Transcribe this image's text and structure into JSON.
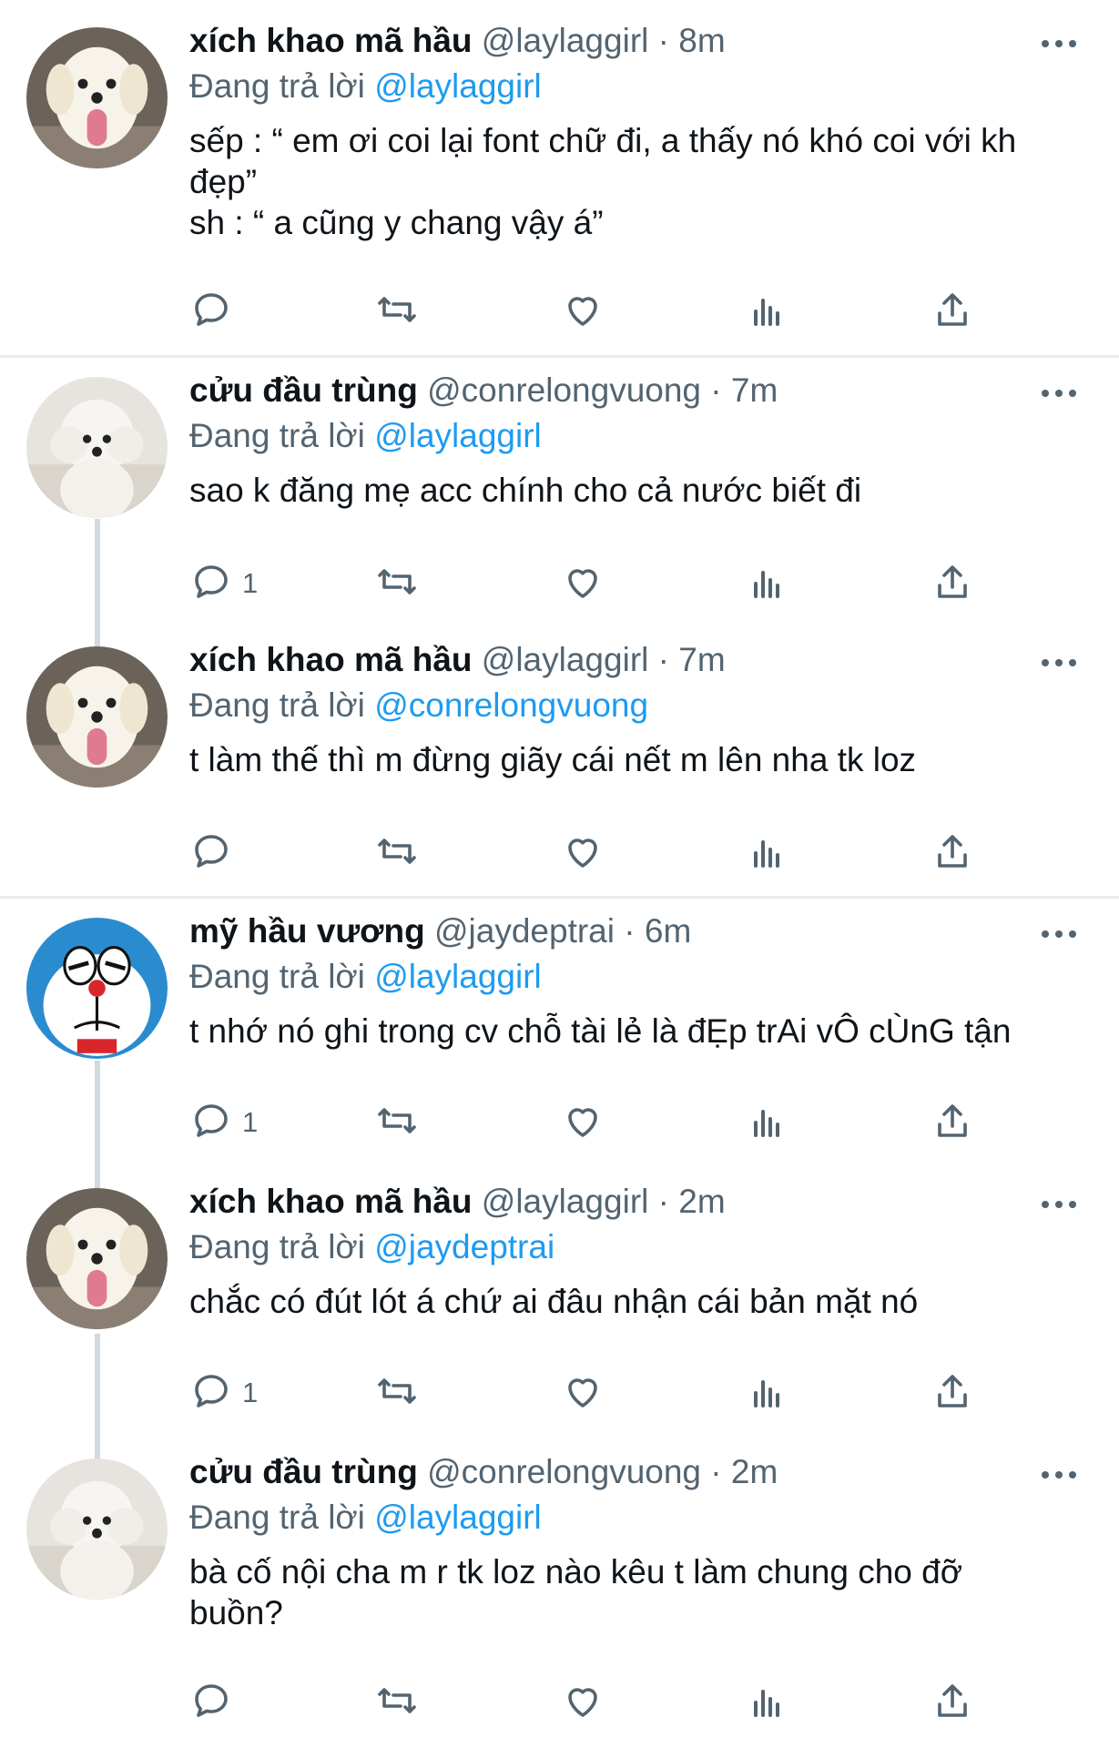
{
  "colors": {
    "link": "#1d9bf0",
    "secondary": "#536471",
    "line": "#cfd9de"
  },
  "reply_prefix": "Đang trả lời",
  "tweets": [
    {
      "name": "xích khao mã hầu",
      "handle": "@laylaggirl",
      "time": "8m",
      "reply_to": "@laylaggirl",
      "lines": [
        "sếp : “ em ơi coi lại font chữ đi, a thấy nó khó coi với kh",
        "đẹp”",
        "sh : “ a cũng y chang vậy á”"
      ],
      "reply_count": "",
      "avatar": "white-dog-tongue"
    },
    {
      "name": "cửu đầu trùng",
      "handle": "@conrelongvuong",
      "time": "7m",
      "reply_to": "@laylaggirl",
      "lines": [
        "sao k đăng mẹ acc chính cho cả nước biết đi"
      ],
      "reply_count": "1",
      "avatar": "poodle"
    },
    {
      "name": "xích khao mã hầu",
      "handle": "@laylaggirl",
      "time": "7m",
      "reply_to": "@conrelongvuong",
      "lines": [
        "t làm thế thì m đừng giãy cái nết m lên nha tk loz"
      ],
      "reply_count": "",
      "avatar": "white-dog-tongue"
    },
    {
      "name": "mỹ hầu vương",
      "handle": "@jaydeptrai",
      "time": "6m",
      "reply_to": "@laylaggirl",
      "lines": [
        "t nhớ nó ghi trong cv chỗ tài lẻ là đẸp trAi vÔ cÙnG tận"
      ],
      "reply_count": "1",
      "avatar": "doraemon"
    },
    {
      "name": "xích khao mã hầu",
      "handle": "@laylaggirl",
      "time": "2m",
      "reply_to": "@jaydeptrai",
      "lines": [
        "chắc có đút lót á chứ ai đâu nhận cái bản mặt nó"
      ],
      "reply_count": "1",
      "avatar": "white-dog-tongue"
    },
    {
      "name": "cửu đầu trùng",
      "handle": "@conrelongvuong",
      "time": "2m",
      "reply_to": "@laylaggirl",
      "lines": [
        "bà cố nội cha m r tk loz nào kêu t làm chung cho đỡ",
        "buồn?"
      ],
      "reply_count": "",
      "avatar": "poodle"
    }
  ]
}
